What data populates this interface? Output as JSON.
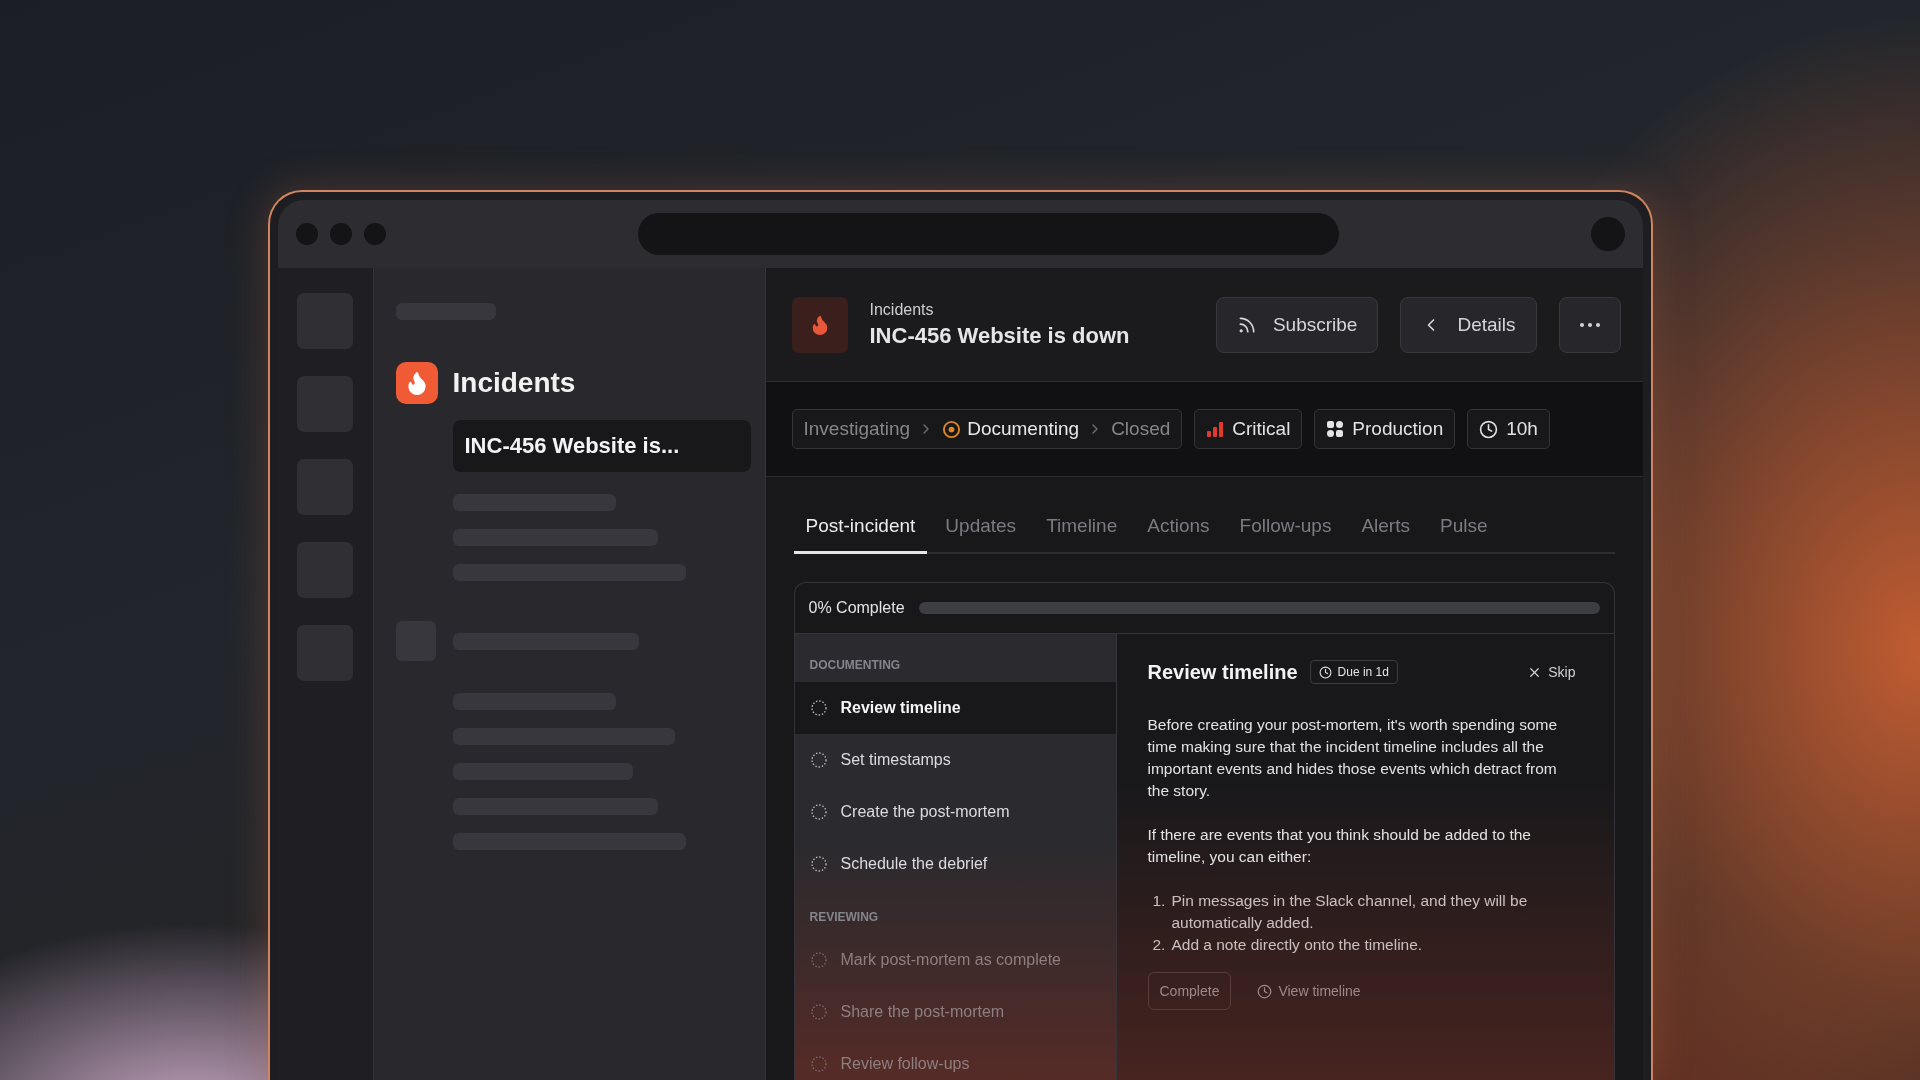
{
  "sidebar": {
    "title": "Incidents",
    "items": [
      {
        "label": "INC-456 Website is...",
        "selected": true
      }
    ]
  },
  "header": {
    "breadcrumb": "Incidents",
    "title": "INC-456 Website is down",
    "buttons": [
      {
        "kind": "subscribe",
        "label": "Subscribe"
      },
      {
        "kind": "details",
        "label": "Details"
      },
      {
        "kind": "more"
      }
    ]
  },
  "status": {
    "stages": [
      {
        "label": "Investigating",
        "selected": false
      },
      {
        "label": "Documenting",
        "selected": true
      },
      {
        "label": "Closed",
        "selected": false
      }
    ],
    "severity": "Critical",
    "environment": "Production",
    "duration": "10h"
  },
  "tabs": [
    {
      "label": "Post-incident",
      "selected": true
    },
    {
      "label": "Updates",
      "selected": false
    },
    {
      "label": "Timeline",
      "selected": false
    },
    {
      "label": "Actions",
      "selected": false
    },
    {
      "label": "Follow-ups",
      "selected": false
    },
    {
      "label": "Alerts",
      "selected": false
    },
    {
      "label": "Pulse",
      "selected": false
    }
  ],
  "progress": {
    "label": "0% Complete",
    "level": 0
  },
  "checklist": [
    {
      "title": "DOCUMENTING",
      "items": [
        {
          "label": "Review timeline",
          "selected": true
        },
        {
          "label": "Set timestamps",
          "selected": false
        },
        {
          "label": "Create the post-mortem",
          "selected": false
        },
        {
          "label": "Schedule the debrief",
          "selected": false
        }
      ]
    },
    {
      "title": "REVIEWING",
      "items": [
        {
          "label": "Mark post-mortem as complete",
          "selected": false
        },
        {
          "label": "Share the post-mortem",
          "selected": false
        },
        {
          "label": "Review follow-ups",
          "selected": false
        }
      ]
    }
  ],
  "detail": {
    "title": "Review timeline",
    "due": "Due in 1d",
    "skip": "Skip",
    "paragraphs": [
      "Before creating your post-mortem, it's worth spending some time making sure that the incident timeline includes all the important events and hides those events which detract from the story.",
      "If there are events that you think should be added to the timeline, you can either:"
    ],
    "steps": [
      {
        "number": "1.",
        "text": "Pin messages in the Slack channel, and they will be automatically added."
      },
      {
        "number": "2.",
        "text": "Add a note directly onto the timeline."
      }
    ],
    "actions": [
      {
        "kind": "button",
        "label": "Complete"
      },
      {
        "kind": "link",
        "label": "View timeline"
      }
    ]
  }
}
